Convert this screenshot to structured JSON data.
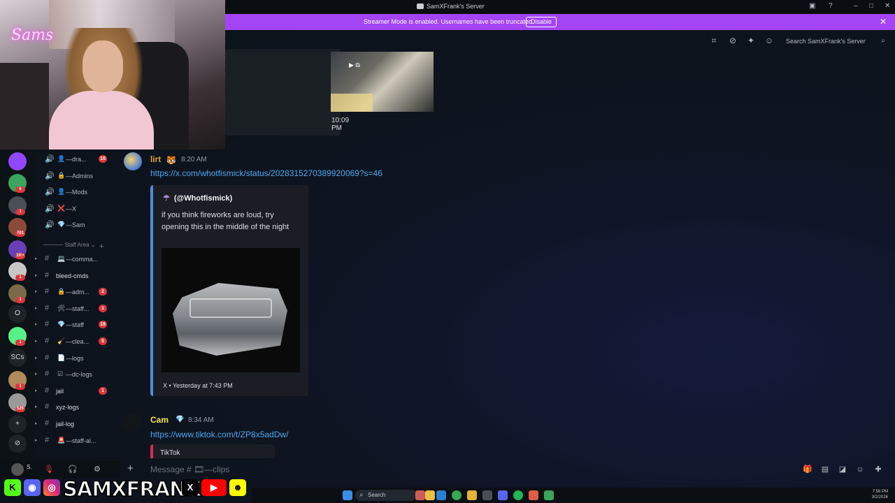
{
  "window": {
    "title": "SamXFrank's Server"
  },
  "banner": {
    "text": "Streamer Mode is enabled. Usernames have been truncated.",
    "button": "Disable"
  },
  "header": {
    "search_placeholder": "Search SamXFrank's Server"
  },
  "webcam": {
    "neon_sign": "Sams"
  },
  "rail": {
    "servers": [
      {
        "icon": "twitch-server",
        "color": "#9146ff"
      },
      {
        "icon": "server-2",
        "color": "#3ba55d",
        "badge": "6"
      },
      {
        "icon": "server-3",
        "color": "#4a4f57",
        "badge": "1"
      },
      {
        "icon": "server-4",
        "color": "#8d4a3a",
        "badge": "701"
      },
      {
        "icon": "server-5",
        "color": "#6a3fb5",
        "badge": "1K+"
      },
      {
        "icon": "server-6",
        "color": "#c7c7c7",
        "badge": "1"
      },
      {
        "icon": "server-7",
        "color": "#7b6a4a",
        "badge": "1"
      },
      {
        "icon": "server-8",
        "letter": "O"
      },
      {
        "icon": "server-9",
        "color": "#57f287",
        "badge": "1"
      },
      {
        "icon": "server-10",
        "letter": "SCs"
      },
      {
        "icon": "server-11",
        "color": "#b08a5a",
        "badge": "1"
      },
      {
        "icon": "server-12",
        "color": "#9a9a9a",
        "badge": "525"
      }
    ]
  },
  "channels": {
    "voice": [
      {
        "name": "—dra...",
        "emoji": "👤",
        "badge": "15"
      },
      {
        "name": "—Admins",
        "emoji": "🔒"
      },
      {
        "name": "—Mods",
        "emoji": "👤"
      },
      {
        "name": "—X",
        "emoji": "❌"
      },
      {
        "name": "—Sam",
        "emoji": "💎"
      }
    ],
    "category": "Staff Area",
    "text": [
      {
        "name": "—comma...",
        "emoji": "💻"
      },
      {
        "name": "bleed-cmds",
        "emoji": ""
      },
      {
        "name": "—adm...",
        "emoji": "🔒",
        "badge": "2"
      },
      {
        "name": "—staff...",
        "emoji": "🛠",
        "badge": "1"
      },
      {
        "name": "—staff",
        "emoji": "💎",
        "badge": "19"
      },
      {
        "name": "—clea...",
        "emoji": "🧹",
        "badge": "5"
      },
      {
        "name": "—logs",
        "emoji": "📄"
      },
      {
        "name": "—dc-logs",
        "emoji": "☑"
      },
      {
        "name": "jail",
        "emoji": "",
        "badge": "1"
      },
      {
        "name": "xyz-logs",
        "emoji": ""
      },
      {
        "name": "jail-log",
        "emoji": ""
      },
      {
        "name": "—staff-al...",
        "emoji": "🚨"
      }
    ]
  },
  "messages": {
    "top": {
      "time": "10:09 PM"
    },
    "m1": {
      "author": "lirt",
      "author_color": "#e3a233",
      "time": "8:20 AM",
      "link": "https://x.com/whotfismick/status/2028315270389920069?s=46",
      "embed": {
        "author": "(@Whotfismick)",
        "description": "if you think fireworks are loud, try opening this in the middle of the night",
        "footer": "X • Yesterday at 7:43 PM"
      }
    },
    "m2": {
      "author": "Cam",
      "author_color": "#f5e14a",
      "time": "8:34 AM",
      "link": "https://www.tiktok.com/t/ZP8x5adDw/",
      "embed_provider": "TikTok"
    }
  },
  "composer": {
    "placeholder": "Message # 🎞—clips"
  },
  "user": {
    "name": "S."
  },
  "overlay": {
    "handle": "SAMXFRANK"
  },
  "taskbar": {
    "search": "Search",
    "time": "7:56 PM",
    "date": "3/2/2026"
  }
}
